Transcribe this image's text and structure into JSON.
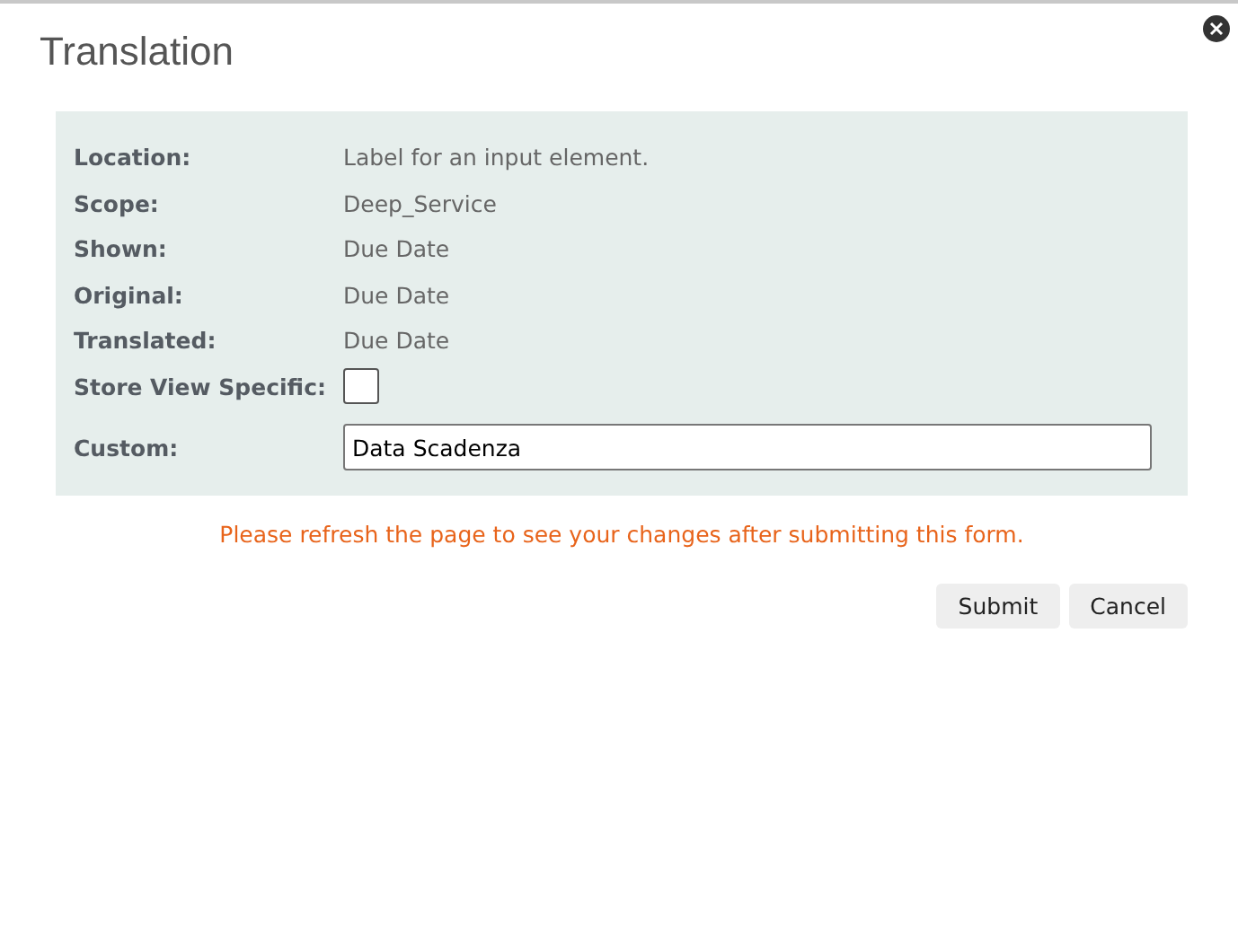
{
  "dialog": {
    "title": "Translation",
    "fields": [
      {
        "kind": "text",
        "label": "Location:",
        "value": "Label for an input element."
      },
      {
        "kind": "text",
        "label": "Scope:",
        "value": "Deep_Service"
      },
      {
        "kind": "text",
        "label": "Shown:",
        "value": "Due Date"
      },
      {
        "kind": "text",
        "label": "Original:",
        "value": "Due Date"
      },
      {
        "kind": "text",
        "label": "Translated:",
        "value": "Due Date"
      },
      {
        "kind": "checkbox",
        "label": "Store View Specific:",
        "checked": false
      },
      {
        "kind": "input",
        "label": "Custom:",
        "value": "Data Scadenza"
      }
    ],
    "notice": "Please refresh the page to see your changes after submitting this form.",
    "buttons": [
      "Submit",
      "Cancel"
    ]
  }
}
